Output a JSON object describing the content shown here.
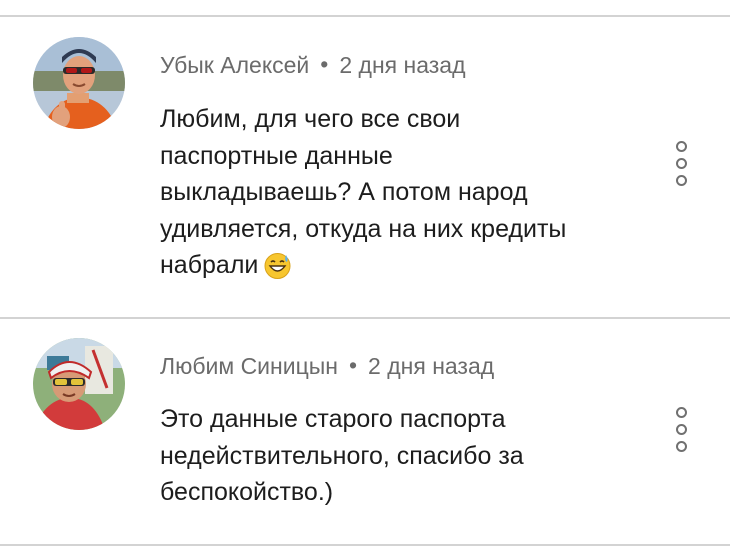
{
  "comments": [
    {
      "author": "Убык Алексей",
      "separator": "•",
      "time": "2 дня назад",
      "lines": [
        "Любим, для чего все свои",
        "паспортные данные",
        "выкладываешь? А потом народ",
        "удивляется, откуда на них кредиты",
        "набрали"
      ],
      "emoji_icon": "grinning-sweat-emoji-icon",
      "avatar_icon": "user-avatar-photo",
      "menu_icon": "more-vertical-icon"
    },
    {
      "author": "Любим Синицын",
      "separator": "•",
      "time": "2 дня назад",
      "lines": [
        "Это данные старого паспорта",
        "недействительного, спасибо за",
        "беспокойство.)"
      ],
      "avatar_icon": "user-avatar-photo",
      "menu_icon": "more-vertical-icon"
    }
  ],
  "colors": {
    "meta_text": "#6b6b6b",
    "body_text": "#1d1d1d",
    "divider": "#d3d3d3",
    "icon": "#707070"
  }
}
